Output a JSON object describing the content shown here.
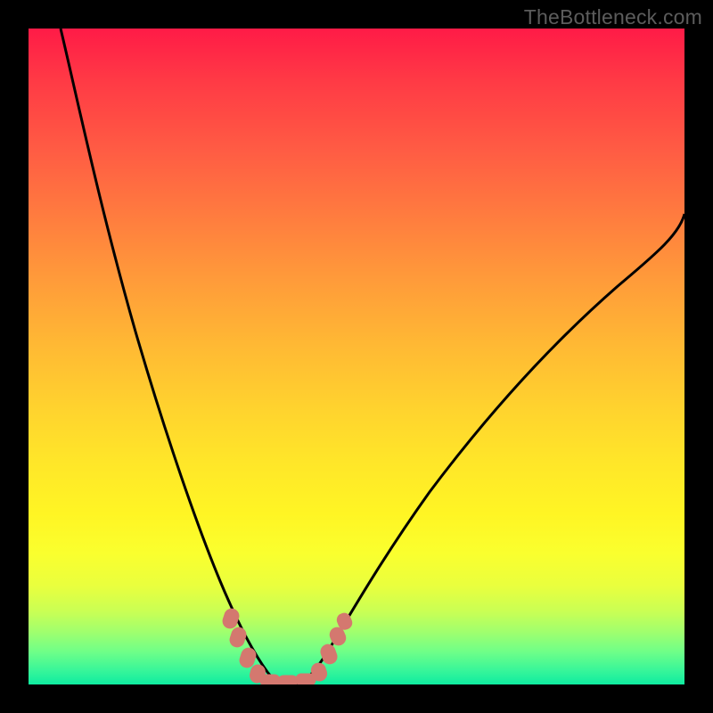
{
  "watermark": {
    "text": "TheBottleneck.com"
  },
  "colors": {
    "frame": "#000000",
    "gradient_stops": [
      "#ff1b47",
      "#ff3a45",
      "#ff5a44",
      "#ff7a3f",
      "#ff9a3a",
      "#ffb834",
      "#ffd32e",
      "#ffe629",
      "#fff524",
      "#faff2e",
      "#e9ff3e",
      "#c8ff55",
      "#a0ff6e",
      "#6fff88",
      "#35f59a",
      "#0feca0"
    ],
    "curve": "#000000",
    "marker": "#d4786f"
  },
  "chart_data": {
    "type": "line",
    "title": "",
    "xlabel": "",
    "ylabel": "",
    "xlim": [
      0,
      100
    ],
    "ylim": [
      0,
      100
    ],
    "series": [
      {
        "name": "left-curve",
        "x": [
          5,
          8,
          12,
          16,
          20,
          24,
          27,
          30,
          32,
          34,
          36,
          38
        ],
        "y": [
          100,
          84,
          66,
          50,
          36,
          24,
          16,
          10,
          6,
          3,
          1,
          0
        ]
      },
      {
        "name": "right-curve",
        "x": [
          41,
          44,
          48,
          54,
          62,
          72,
          84,
          100
        ],
        "y": [
          0,
          3,
          8,
          16,
          27,
          40,
          54,
          72
        ]
      }
    ],
    "markers": {
      "name": "highlighted-points",
      "shape": "rounded-capsule",
      "color": "#d4786f",
      "points_xy": [
        [
          30.5,
          10
        ],
        [
          31.5,
          7.5
        ],
        [
          33,
          4
        ],
        [
          34.5,
          1.5
        ],
        [
          36,
          0.5
        ],
        [
          37.5,
          0.3
        ],
        [
          39,
          0.3
        ],
        [
          40.5,
          0.5
        ],
        [
          42,
          1.5
        ],
        [
          44,
          4
        ],
        [
          45,
          6.5
        ],
        [
          46,
          9
        ]
      ]
    },
    "interpretation": "V-shaped bottleneck curve; y approaches 0 near x≈38–41 (optimal region highlighted by markers), rises steeply toward 100 as x→5 and more gradually toward ~72 as x→100. Background gradient encodes y: green≈0 (good) → red≈100 (bad)."
  }
}
